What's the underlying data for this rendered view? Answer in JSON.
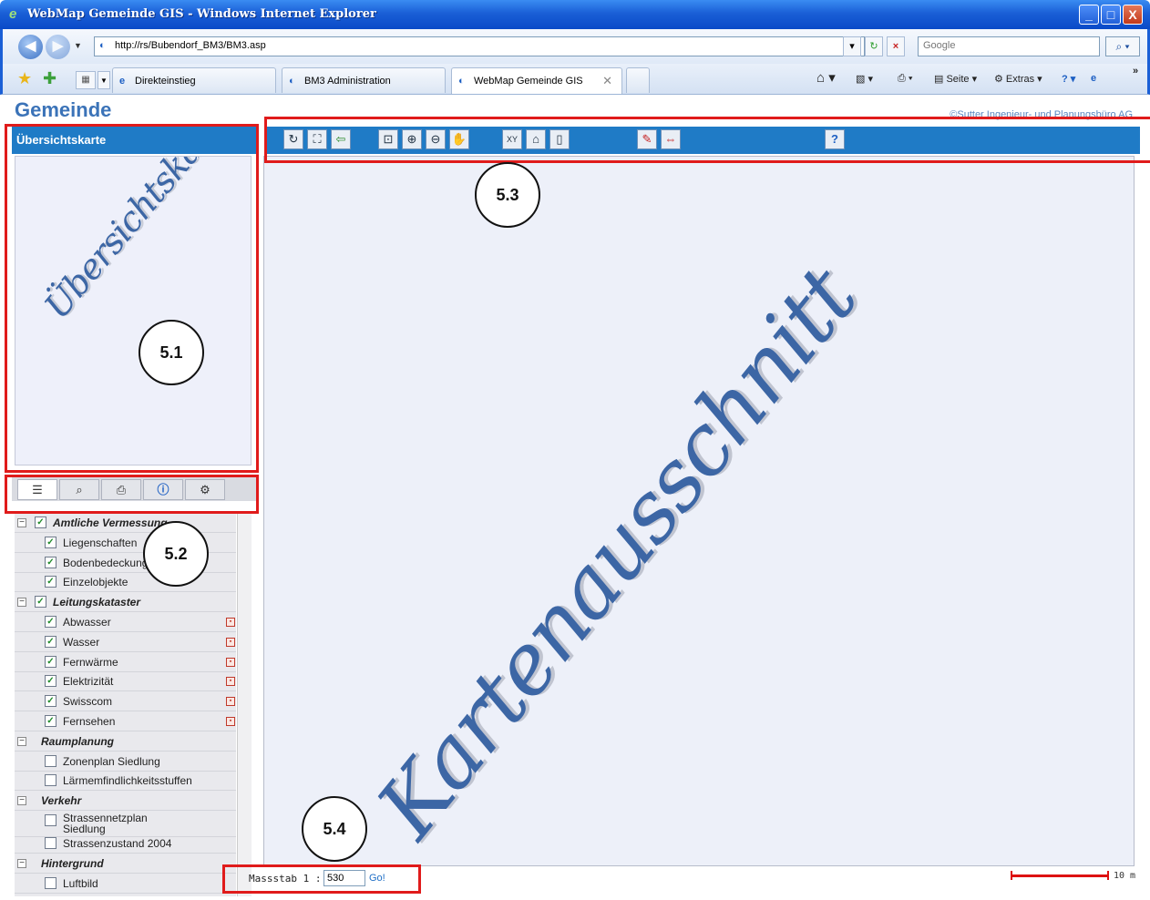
{
  "window": {
    "title": "WebMap Gemeinde GIS - Windows Internet Explorer",
    "minimize": "_",
    "maximize": "□",
    "close": "X"
  },
  "address_bar": {
    "url": "http://rs/Bubendorf_BM3/BM3.asp",
    "search_placeholder": "Google"
  },
  "tabs": [
    {
      "label": "Direkteinstieg"
    },
    {
      "label": "BM3 Administration"
    },
    {
      "label": "WebMap Gemeinde GIS"
    }
  ],
  "command_bar": {
    "page": "Seite",
    "extras": "Extras"
  },
  "page": {
    "brand": "Gemeinde",
    "copyright": "©Sutter Ingenieur- und Planungsbüro AG"
  },
  "overview": {
    "header": "Übersichtskarte",
    "watermark": "Übersichtskarte"
  },
  "map": {
    "watermark": "Kartenausschnitt"
  },
  "toolbar_icons": [
    "refresh-icon",
    "full-extent-icon",
    "back-icon",
    "zoom-window-icon",
    "zoom-in-icon",
    "zoom-out-icon",
    "pan-icon",
    "coordinate-icon",
    "profile-icon",
    "print-area-icon",
    "label-icon",
    "measure-icon",
    "help-icon"
  ],
  "panel_tabs": [
    "legend-icon",
    "search-icon",
    "print-icon",
    "info-icon",
    "tools-icon"
  ],
  "layers": [
    {
      "label": "Amtliche Vermessung",
      "group": true,
      "checked": true
    },
    {
      "label": "Liegenschaften",
      "group": false,
      "checked": true
    },
    {
      "label": "Bodenbedeckung",
      "group": false,
      "checked": true
    },
    {
      "label": "Einzelobjekte",
      "group": false,
      "checked": true
    },
    {
      "label": "Leitungskataster",
      "group": true,
      "checked": true
    },
    {
      "label": "Abwasser",
      "group": false,
      "checked": true,
      "legend": true
    },
    {
      "label": "Wasser",
      "group": false,
      "checked": true,
      "legend": true
    },
    {
      "label": "Fernwärme",
      "group": false,
      "checked": true,
      "legend": true
    },
    {
      "label": "Elektrizität",
      "group": false,
      "checked": true,
      "legend": true
    },
    {
      "label": "Swisscom",
      "group": false,
      "checked": true,
      "legend": true
    },
    {
      "label": "Fernsehen",
      "group": false,
      "checked": true,
      "legend": true
    },
    {
      "label": "Raumplanung",
      "group": true,
      "checked": null
    },
    {
      "label": "Zonenplan Siedlung",
      "group": false,
      "checked": false
    },
    {
      "label": "Lärmemfindlichkeitsstuffen",
      "group": false,
      "checked": false
    },
    {
      "label": "Verkehr",
      "group": true,
      "checked": null
    },
    {
      "label": "Strassennetzplan Siedlung",
      "group": false,
      "checked": false
    },
    {
      "label": "Strassenzustand 2004",
      "group": false,
      "checked": false
    },
    {
      "label": "Hintergrund",
      "group": true,
      "checked": null
    },
    {
      "label": "Luftbild",
      "group": false,
      "checked": false
    }
  ],
  "scale": {
    "label": "Massstab 1 :",
    "value": "530",
    "go": "Go!",
    "bar_label": "10 m"
  },
  "annotations": {
    "overview": "5.1",
    "panel": "5.2",
    "toolbar": "5.3",
    "scale": "5.4"
  }
}
